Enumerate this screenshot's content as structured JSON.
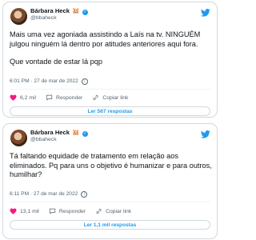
{
  "tweets": [
    {
      "author": "Bárbara Heck",
      "emoji": "🐹",
      "handle": "@bbaheck",
      "lines": [
        "Mais uma vez agoniada assistindo a Laís na tv. NINGUÉM julgou ninguém lá dentro por atitudes anteriores aqui fora.",
        "Que vontade de estar lá pqp"
      ],
      "time": "6:01 PM · 27 de mar de 2022",
      "likes": "6,2 mil",
      "reply_label": "Responder",
      "copy_label": "Copiar link",
      "read_replies": "Ler 567 respostas"
    },
    {
      "author": "Bárbara Heck",
      "emoji": "🐹",
      "handle": "@bbaheck",
      "lines": [
        "Tá faltando equidade de tratamento em relação aos eliminados. Pq para uns o objetivo é humanizar e para outros, humilhar?"
      ],
      "time": "6:11 PM · 27 de mar de 2022",
      "likes": "13,1 mil",
      "reply_label": "Responder",
      "copy_label": "Copiar link",
      "read_replies": "Ler 1,1 mil respostas"
    }
  ],
  "colors": {
    "accent": "#1d9bf0",
    "like": "#f91880",
    "muted": "#536471",
    "border": "#cfd9de"
  },
  "icons": {
    "logo": "twitter-bird-icon",
    "like": "heart-icon",
    "reply": "speech-bubble-icon",
    "copy": "link-icon",
    "info": "info-icon",
    "verified": "verified-badge-icon"
  }
}
